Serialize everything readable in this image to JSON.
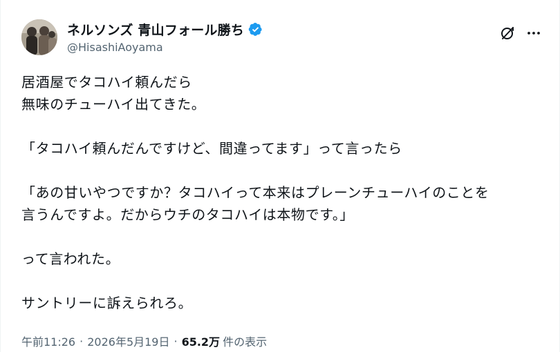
{
  "user": {
    "display_name": "ネルソンズ 青山フォール勝ち",
    "handle": "@HisashiAoyama",
    "verified": true,
    "verified_color": "#1d9bf0"
  },
  "actions": {
    "grok_icon": "grok-slash-circle-icon",
    "more_icon": "more-dots-icon"
  },
  "tweet": {
    "text": "居酒屋でタコハイ頼んだら\n無味のチューハイ出てきた。\n\n「タコハイ頼んだんですけど、間違ってます」って言ったら\n\n「あの甘いやつですか？タコハイって本来はプレーンチューハイのことを\n言うんですよ。だからウチのタコハイは本物です。」\n\nって言われた。\n\nサントリーに訴えられろ。"
  },
  "meta": {
    "time": "午前11:26",
    "separator": "·",
    "date": "2026年5月19日",
    "views_count": "65.2万",
    "views_label": "件の表示"
  }
}
